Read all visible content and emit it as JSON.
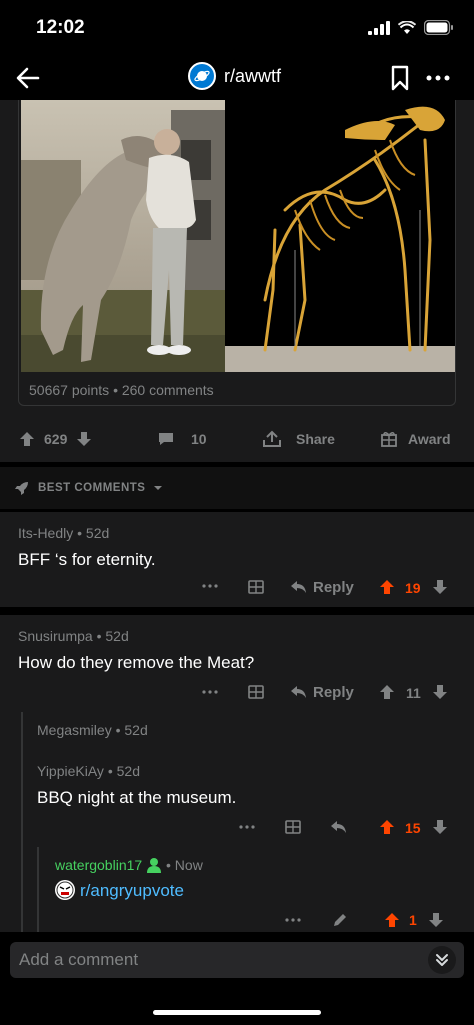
{
  "status": {
    "time": "12:02"
  },
  "nav": {
    "title": "r/awwtf"
  },
  "post": {
    "meta": "50667 points • 260 comments",
    "votes": "629",
    "comments": "10",
    "share_label": "Share",
    "award_label": "Award"
  },
  "sort": {
    "label": "BEST COMMENTS"
  },
  "comments": [
    {
      "author": "Its-Hedly",
      "age": "52d",
      "body": "BFF ‘s for eternity.",
      "reply_label": "Reply",
      "score": "19",
      "upvoted": true
    },
    {
      "author": "Snusirumpa",
      "age": "52d",
      "body": "How do they remove the Meat?",
      "reply_label": "Reply",
      "score": "11",
      "upvoted": false
    },
    {
      "author": "Megasmiley",
      "age": "52d"
    },
    {
      "author": "YippieKiAy",
      "age": "52d",
      "body": "BBQ night at the museum.",
      "score": "15",
      "upvoted": true
    },
    {
      "author": "watergoblin17",
      "age": "Now",
      "body": "r/angryupvote",
      "score": "1",
      "upvoted": true
    }
  ],
  "composer": {
    "placeholder": "Add a comment"
  },
  "colors": {
    "accent_orange": "#ff4500",
    "link_blue": "#4fbcff",
    "author_green": "#46d160",
    "subreddit_blue": "#0079d3"
  }
}
